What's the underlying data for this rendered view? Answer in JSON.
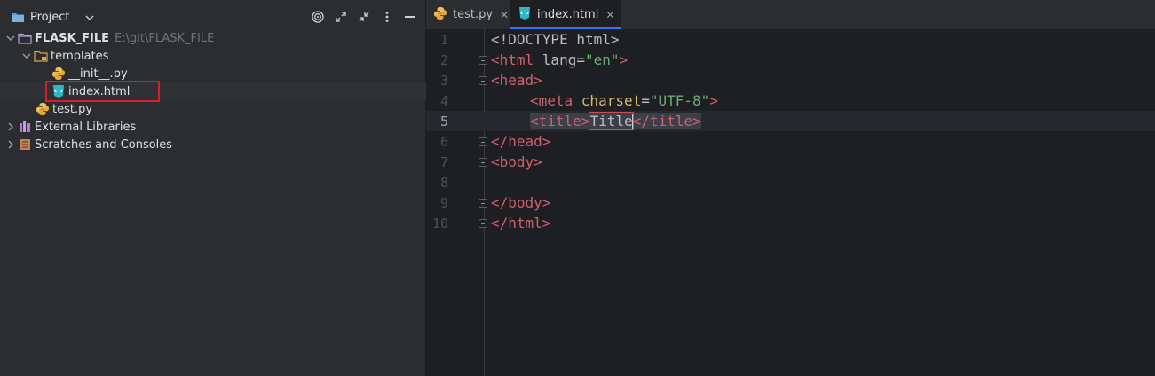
{
  "project": {
    "title": "Project",
    "tools": [
      "target-icon",
      "expand-icon",
      "collapse-icon",
      "more-icon",
      "minimize-icon"
    ]
  },
  "tree": {
    "root_label": "FLASK_FILE",
    "root_path": "E:\\git\\FLASK_FILE",
    "templates_label": "templates",
    "init_label": "__init__.py",
    "index_label": "index.html",
    "test_label": "test.py",
    "ext_libs_label": "External Libraries",
    "scratches_label": "Scratches and Consoles"
  },
  "tabs": [
    {
      "label": "test.py",
      "icon": "python-icon",
      "active": false
    },
    {
      "label": "index.html",
      "icon": "html-icon",
      "active": true
    }
  ],
  "editor": {
    "current_line": 5,
    "line_numbers": [
      "1",
      "2",
      "3",
      "4",
      "5",
      "6",
      "7",
      "8",
      "9",
      "10"
    ],
    "lines": {
      "l1": "<!DOCTYPE html>",
      "l2a": "<html ",
      "l2b": "lang",
      "l2c": "=",
      "l2d": "\"en\"",
      "l2e": ">",
      "l3": "<head>",
      "l4a": "<meta ",
      "l4b": "charset",
      "l4c": "=",
      "l4d": "\"UTF-8\"",
      "l4e": ">",
      "l5a": "<title>",
      "l5b": "Title",
      "l5c": "</title>",
      "l6": "</head>",
      "l7": "<body>",
      "l9": "</body>",
      "l10": "</html>"
    }
  },
  "colors": {
    "accent": "#3574f0",
    "highlight_box": "#e01b24",
    "tag": "#cf6171",
    "string": "#6aab73"
  }
}
